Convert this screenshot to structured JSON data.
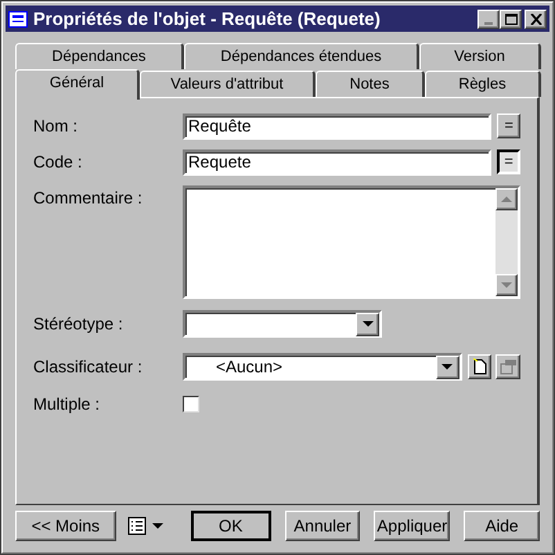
{
  "window": {
    "title": "Propriétés de l'objet - Requête (Requete)"
  },
  "tab_rows": [
    [
      {
        "label": "Dépendances",
        "selected": false
      },
      {
        "label": "Dépendances étendues",
        "selected": false
      },
      {
        "label": "Version",
        "selected": false
      }
    ],
    [
      {
        "label": "Général",
        "selected": true
      },
      {
        "label": "Valeurs d'attribut",
        "selected": false
      },
      {
        "label": "Notes",
        "selected": false
      },
      {
        "label": "Règles",
        "selected": false
      }
    ]
  ],
  "fields": [
    {
      "kind": "text",
      "label": "Nom :",
      "value": "Requête",
      "button": "=",
      "pressed": false
    },
    {
      "kind": "text",
      "label": "Code :",
      "value": "Requete",
      "button": "=",
      "pressed": true
    },
    {
      "kind": "textarea",
      "label": "Commentaire :"
    },
    {
      "kind": "combo",
      "label": "Stéréotype :",
      "wide": false
    },
    {
      "kind": "combo",
      "label": "Classificateur :",
      "value": "<Aucun>",
      "wide": true,
      "tools": true
    },
    {
      "kind": "checkbox",
      "label": "Multiple :",
      "checked": false
    }
  ],
  "buttons": [
    {
      "label": "<< Moins"
    },
    {
      "label": "OK",
      "default": true
    },
    {
      "label": "Annuler"
    },
    {
      "label": "Appliquer"
    },
    {
      "label": "Aide"
    }
  ]
}
